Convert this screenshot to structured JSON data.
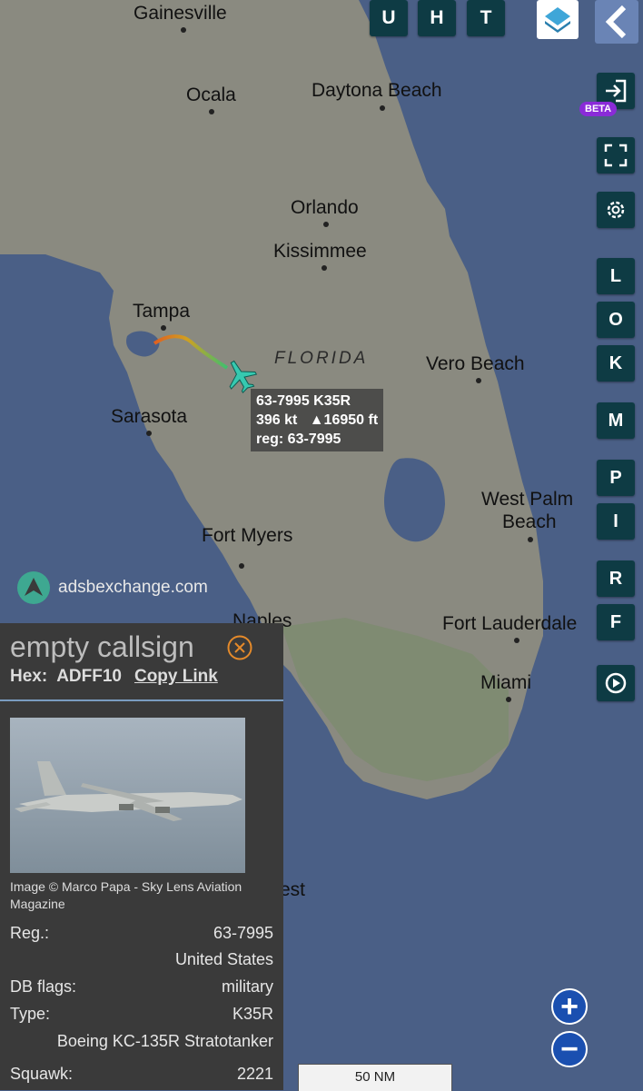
{
  "map": {
    "state_label": "FLORIDA",
    "cities": [
      {
        "name": "Gainesville"
      },
      {
        "name": "Ocala"
      },
      {
        "name": "Daytona Beach"
      },
      {
        "name": "Orlando"
      },
      {
        "name": "Kissimmee"
      },
      {
        "name": "Tampa"
      },
      {
        "name": "Vero Beach"
      },
      {
        "name": "Sarasota"
      },
      {
        "name": "West Palm"
      },
      {
        "name": "Beach"
      },
      {
        "name": "Fort Myers"
      },
      {
        "name": "Naples"
      },
      {
        "name": "Fort Lauderdale"
      },
      {
        "name": "Miami"
      },
      {
        "name": "est"
      }
    ],
    "colors": {
      "land": "#8c8c82",
      "water": "#4a5f86",
      "track_start": "#e06020",
      "track_end": "#3fbf6f",
      "aircraft": "#36c9b0"
    }
  },
  "aircraft_label": {
    "line1": "63-7995 K35R",
    "speed": "396 kt",
    "altitude": "▲16950 ft",
    "line3": "reg: 63-7995"
  },
  "toolbar_top": {
    "u": "U",
    "h": "H",
    "t": "T"
  },
  "right_buttons": {
    "l": "L",
    "o": "O",
    "k": "K",
    "m": "M",
    "p": "P",
    "i": "I",
    "r": "R",
    "f": "F",
    "beta": "BETA"
  },
  "branding": {
    "site": "adsbexchange.com"
  },
  "panel": {
    "callsign": "empty callsign",
    "hex_label": "Hex:",
    "hex_value": "ADFF10",
    "copy_link": "Copy Link",
    "photo_caption": "Image © Marco Papa - Sky Lens Aviation Magazine",
    "rows": {
      "reg_label": "Reg.:",
      "reg_value": "63-7995",
      "country": "United States",
      "dbflags_label": "DB flags:",
      "dbflags_value": "military",
      "type_label": "Type:",
      "type_value": "K35R",
      "type_full": "Boeing KC-135R Stratotanker",
      "squawk_label": "Squawk:",
      "squawk_value": "2221"
    }
  },
  "scale": {
    "label": "50 NM"
  },
  "zoom": {
    "in": "+",
    "out": "−"
  }
}
